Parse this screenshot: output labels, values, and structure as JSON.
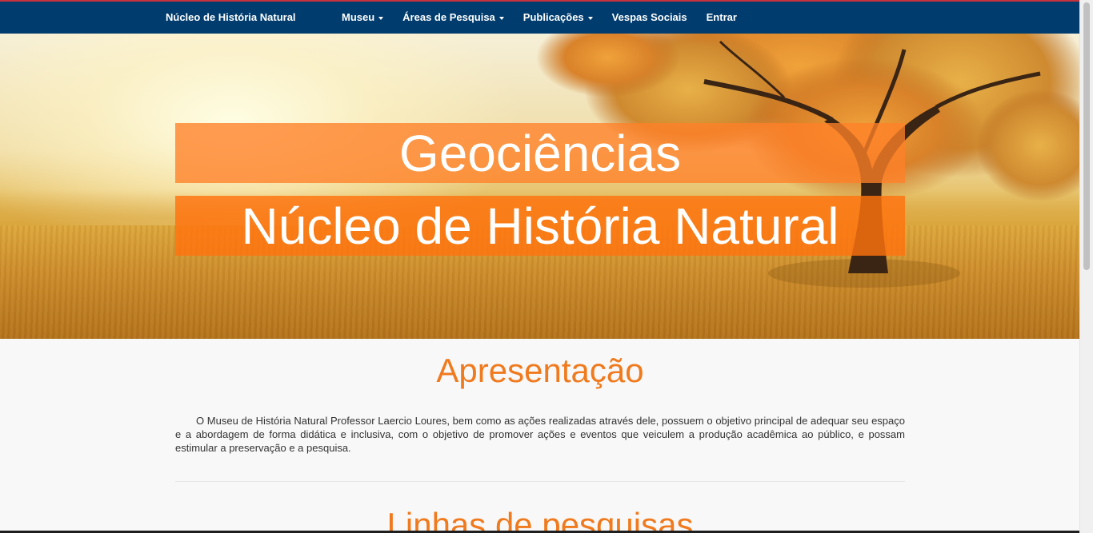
{
  "navbar": {
    "brand": "Núcleo de História Natural",
    "items": [
      {
        "label": "Museu",
        "dropdown": true
      },
      {
        "label": "Áreas de Pesquisa",
        "dropdown": true
      },
      {
        "label": "Publicações",
        "dropdown": true
      },
      {
        "label": "Vespas Sociais",
        "dropdown": false
      },
      {
        "label": "Entrar",
        "dropdown": false
      }
    ]
  },
  "hero": {
    "title": "Geociências",
    "subtitle": "Núcleo de História Natural"
  },
  "presentation": {
    "title": "Apresentação",
    "text": "O Museu de História Natural Professor Laercio Loures, bem como as ações realizadas através dele, possuem o objetivo principal de adequar seu espaço e a abordagem de forma didática e inclusiva, com o objetivo de promover ações e eventos que veiculem a produção acadêmica ao público, e possam estimular a preservação e a pesquisa."
  },
  "research": {
    "title": "Linhas de pesquisas"
  },
  "colors": {
    "navbar": "#003c6e",
    "navbar_top_border": "#c8323c",
    "accent": "#f07a1e",
    "banner": "#ff8028"
  }
}
